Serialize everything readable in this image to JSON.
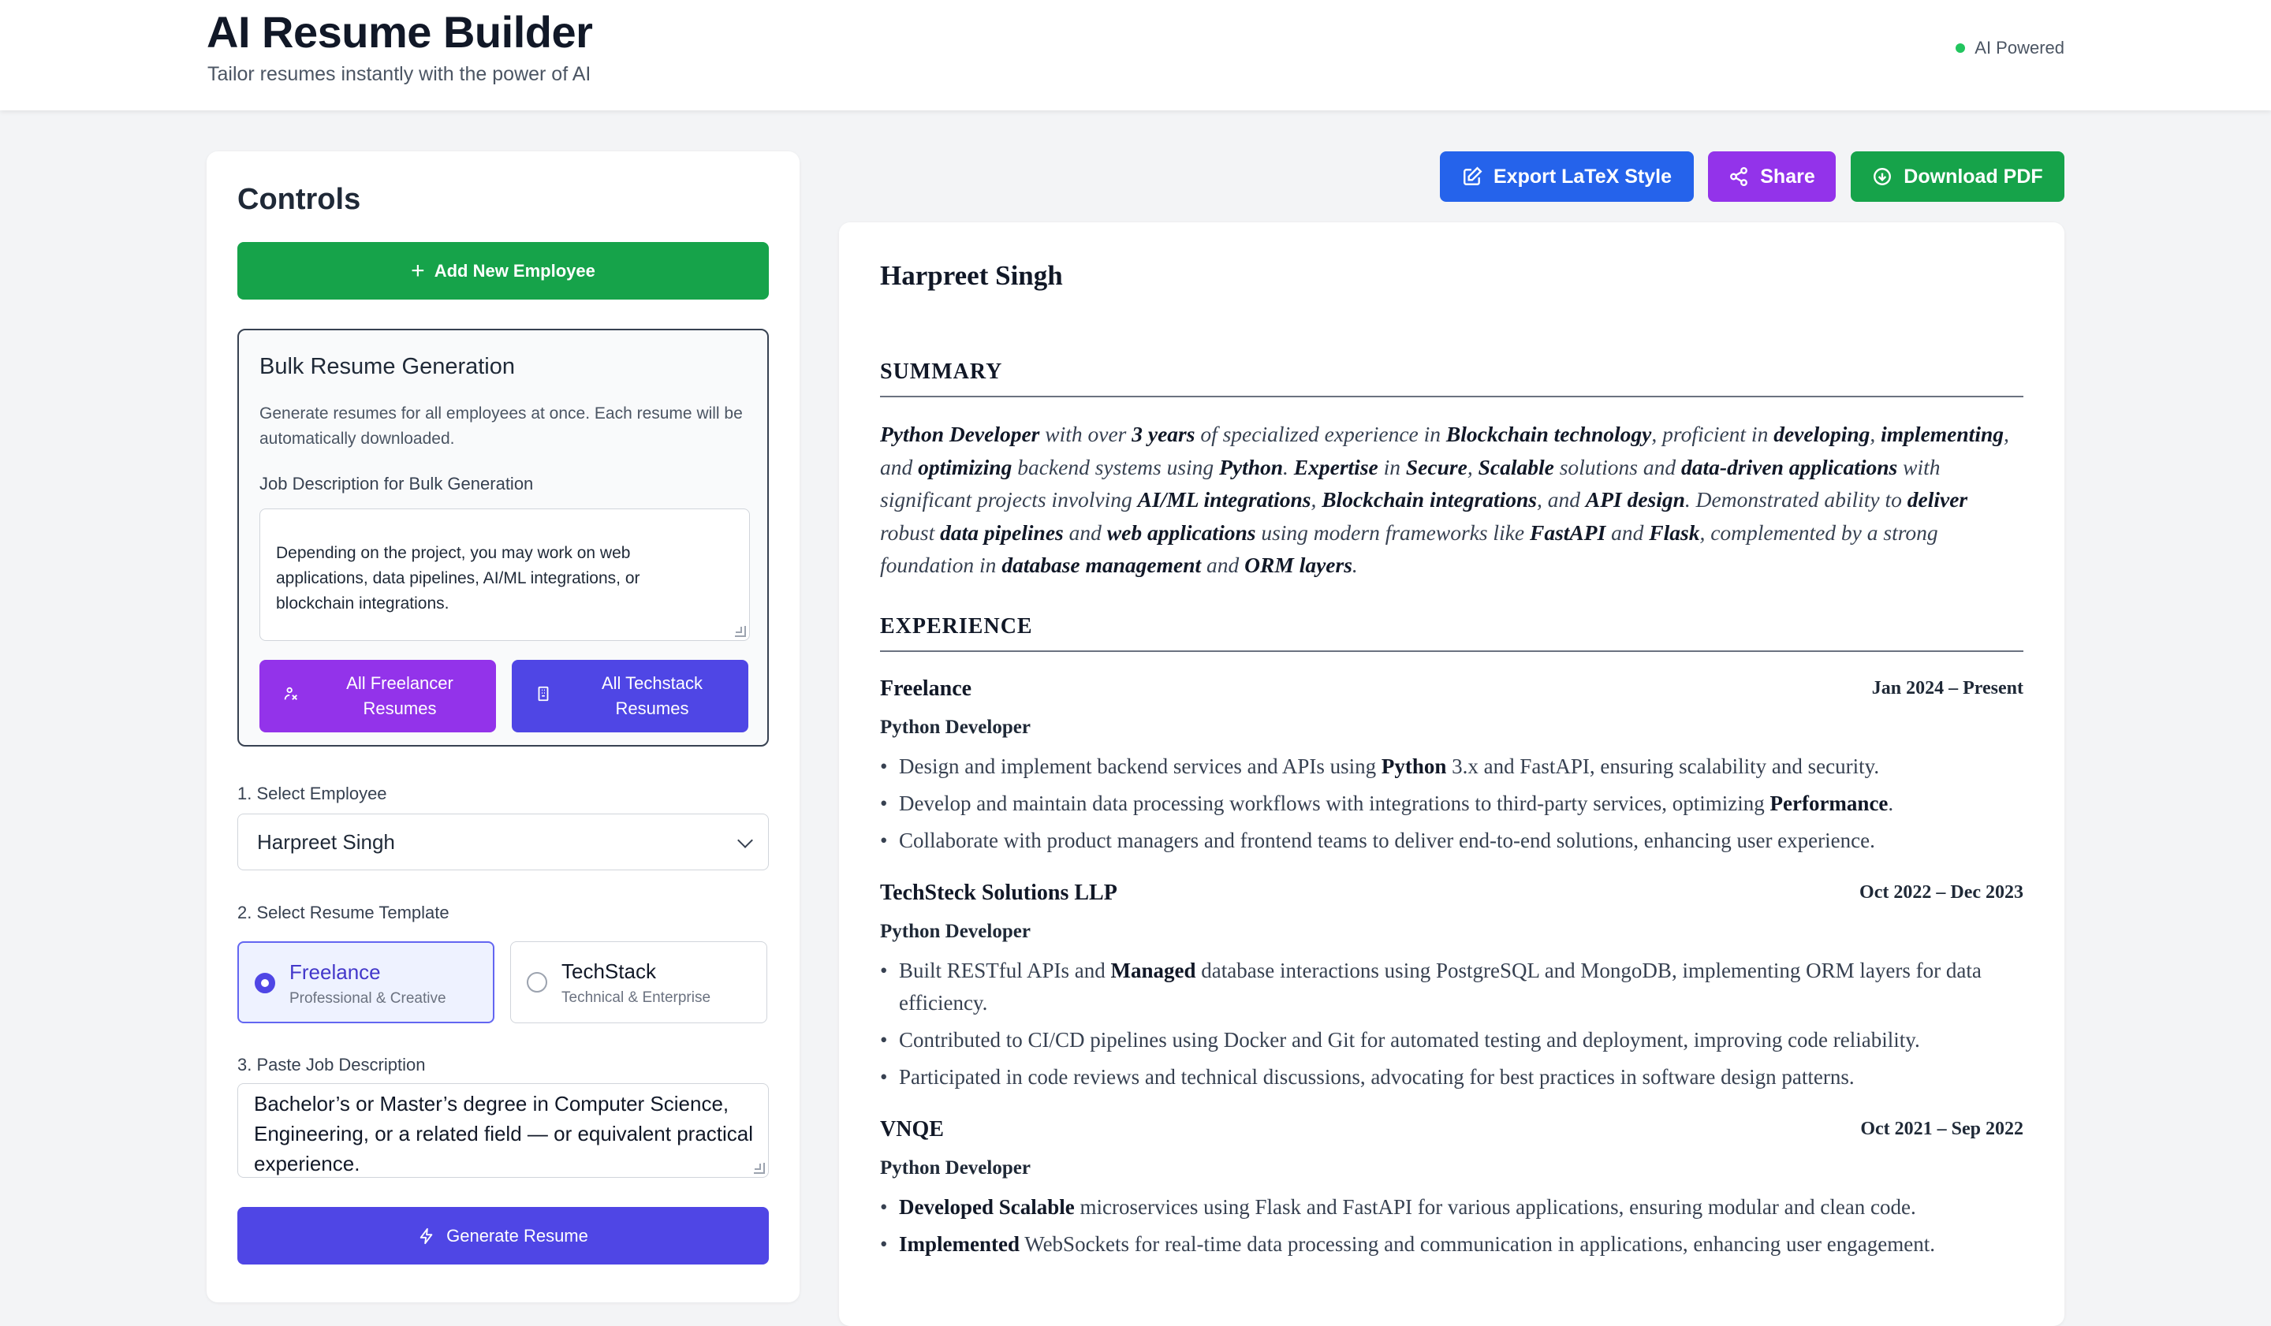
{
  "header": {
    "title": "AI Resume Builder",
    "subtitle": "Tailor resumes instantly with the power of AI",
    "badge": "AI Powered"
  },
  "controls": {
    "title": "Controls",
    "add_employee": "Add New Employee",
    "bulk": {
      "title": "Bulk Resume Generation",
      "description": "Generate resumes for all employees at once. Each resume will be automatically downloaded.",
      "jd_label": "Job Description for Bulk Generation",
      "jd_text": "Depending on the project, you may work on web applications, data pipelines, AI/ML integrations, or blockchain integrations.",
      "btn_freelancer": "All Freelancer Resumes",
      "btn_techstack": "All Techstack Resumes"
    },
    "select_employee_label": "1. Select Employee",
    "selected_employee": "Harpreet Singh",
    "template_label": "2. Select Resume Template",
    "templates": [
      {
        "name": "Freelance",
        "sub": "Professional & Creative",
        "selected": true
      },
      {
        "name": "TechStack",
        "sub": "Technical & Enterprise",
        "selected": false
      }
    ],
    "jd_label": "3. Paste Job Description",
    "jd_text": "Bachelor’s or Master’s degree in Computer Science, Engineering, or a related field — or equivalent practical experience.",
    "generate": "Generate Resume"
  },
  "actions": {
    "export": "Export LaTeX Style",
    "share": "Share",
    "download": "Download PDF"
  },
  "resume": {
    "name": "Harpreet Singh",
    "summary_heading": "SUMMARY",
    "experience_heading": "EXPERIENCE",
    "jobs": [
      {
        "company": "Freelance",
        "dates": "Jan 2024 – Present",
        "role": "Python Developer"
      },
      {
        "company": "TechSteck Solutions LLP",
        "dates": "Oct 2022 – Dec 2023",
        "role": "Python Developer"
      },
      {
        "company": "VNQE",
        "dates": "Oct 2021 – Sep 2022",
        "role": "Python Developer"
      }
    ]
  },
  "colors": {
    "accent_indigo": "#4f46e5",
    "green": "#16a34a",
    "purple": "#9333ea",
    "blue": "#2563eb",
    "status_dot": "#22c55e"
  }
}
